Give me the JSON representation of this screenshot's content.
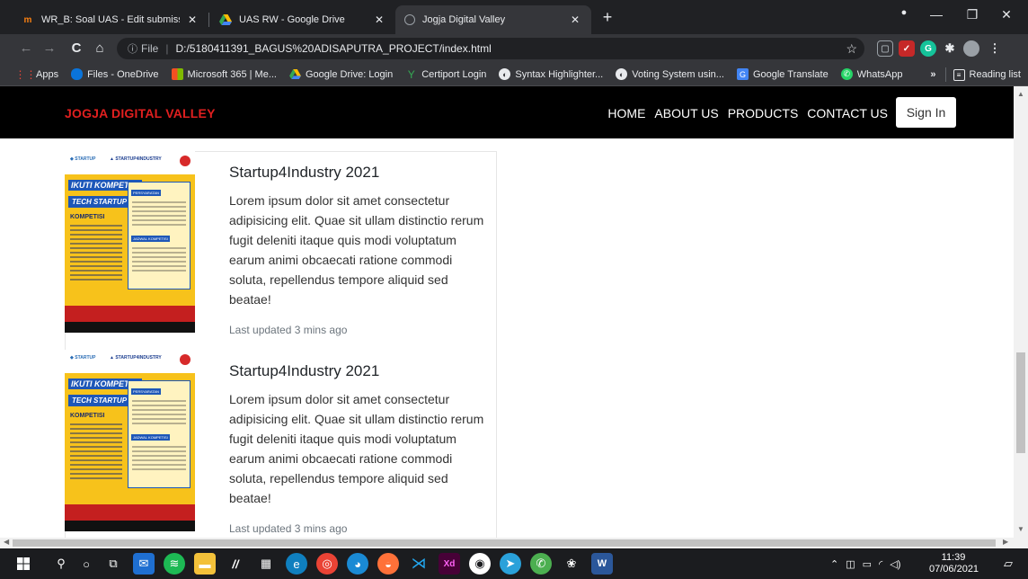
{
  "browser": {
    "tabs": [
      {
        "title": "WR_B: Soal UAS - Edit submission",
        "icon": "moodle-icon",
        "active": false
      },
      {
        "title": "UAS RW - Google Drive",
        "icon": "google-drive-icon",
        "active": false
      },
      {
        "title": "Jogja Digital Valley",
        "icon": "globe-icon",
        "active": true
      }
    ],
    "new_tab": "+",
    "window_controls": {
      "minimize": "—",
      "restore": "❐",
      "close": "✕"
    },
    "address": {
      "scheme": "File",
      "url": "D:/5180411391_BAGUS%20ADISAPUTRA_PROJECT/index.html"
    },
    "bookmarks": [
      {
        "label": "Apps",
        "icon": "apps-grid-icon",
        "color": "#ea4335"
      },
      {
        "label": "Files - OneDrive",
        "icon": "onedrive-icon",
        "color": "#0a74da"
      },
      {
        "label": "Microsoft 365 | Me...",
        "icon": "microsoft-icon",
        "color": "#f25022"
      },
      {
        "label": "Google Drive: Login",
        "icon": "google-drive-icon",
        "color": "#fbbc04"
      },
      {
        "label": "Certiport Login",
        "icon": "certiport-icon",
        "color": "#34a853"
      },
      {
        "label": "Syntax Highlighter...",
        "icon": "globe-icon",
        "color": "#5f6368"
      },
      {
        "label": "Voting System usin...",
        "icon": "globe-icon",
        "color": "#5f6368"
      },
      {
        "label": "Google Translate",
        "icon": "google-translate-icon",
        "color": "#4285f4"
      },
      {
        "label": "WhatsApp",
        "icon": "whatsapp-icon",
        "color": "#25d366"
      }
    ],
    "bookmarks_overflow": "»",
    "reading_list": "Reading list"
  },
  "site": {
    "brand": "JOGJA DIGITAL VALLEY",
    "menu": [
      "HOME",
      "ABOUT US",
      "PRODUCTS",
      "CONTACT US"
    ],
    "signin": "Sign In",
    "cards": [
      {
        "title": "Startup4Industry 2021",
        "text": "Lorem ipsum dolor sit amet consectetur adipisicing elit. Quae sit ullam distinctio rerum fugit deleniti itaque quis modi voluptatum earum animi obcaecati ratione commodi soluta, repellendus tempore aliquid sed beatae!",
        "meta": "Last updated 3 mins ago"
      },
      {
        "title": "Startup4Industry 2021",
        "text": "Lorem ipsum dolor sit amet consectetur adipisicing elit. Quae sit ullam distinctio rerum fugit deleniti itaque quis modi voluptatum earum animi obcaecati ratione commodi soluta, repellendus tempore aliquid sed beatae!",
        "meta": "Last updated 3 mins ago"
      }
    ]
  },
  "taskbar": {
    "clock_time": "11:39",
    "clock_date": "07/06/2021"
  }
}
